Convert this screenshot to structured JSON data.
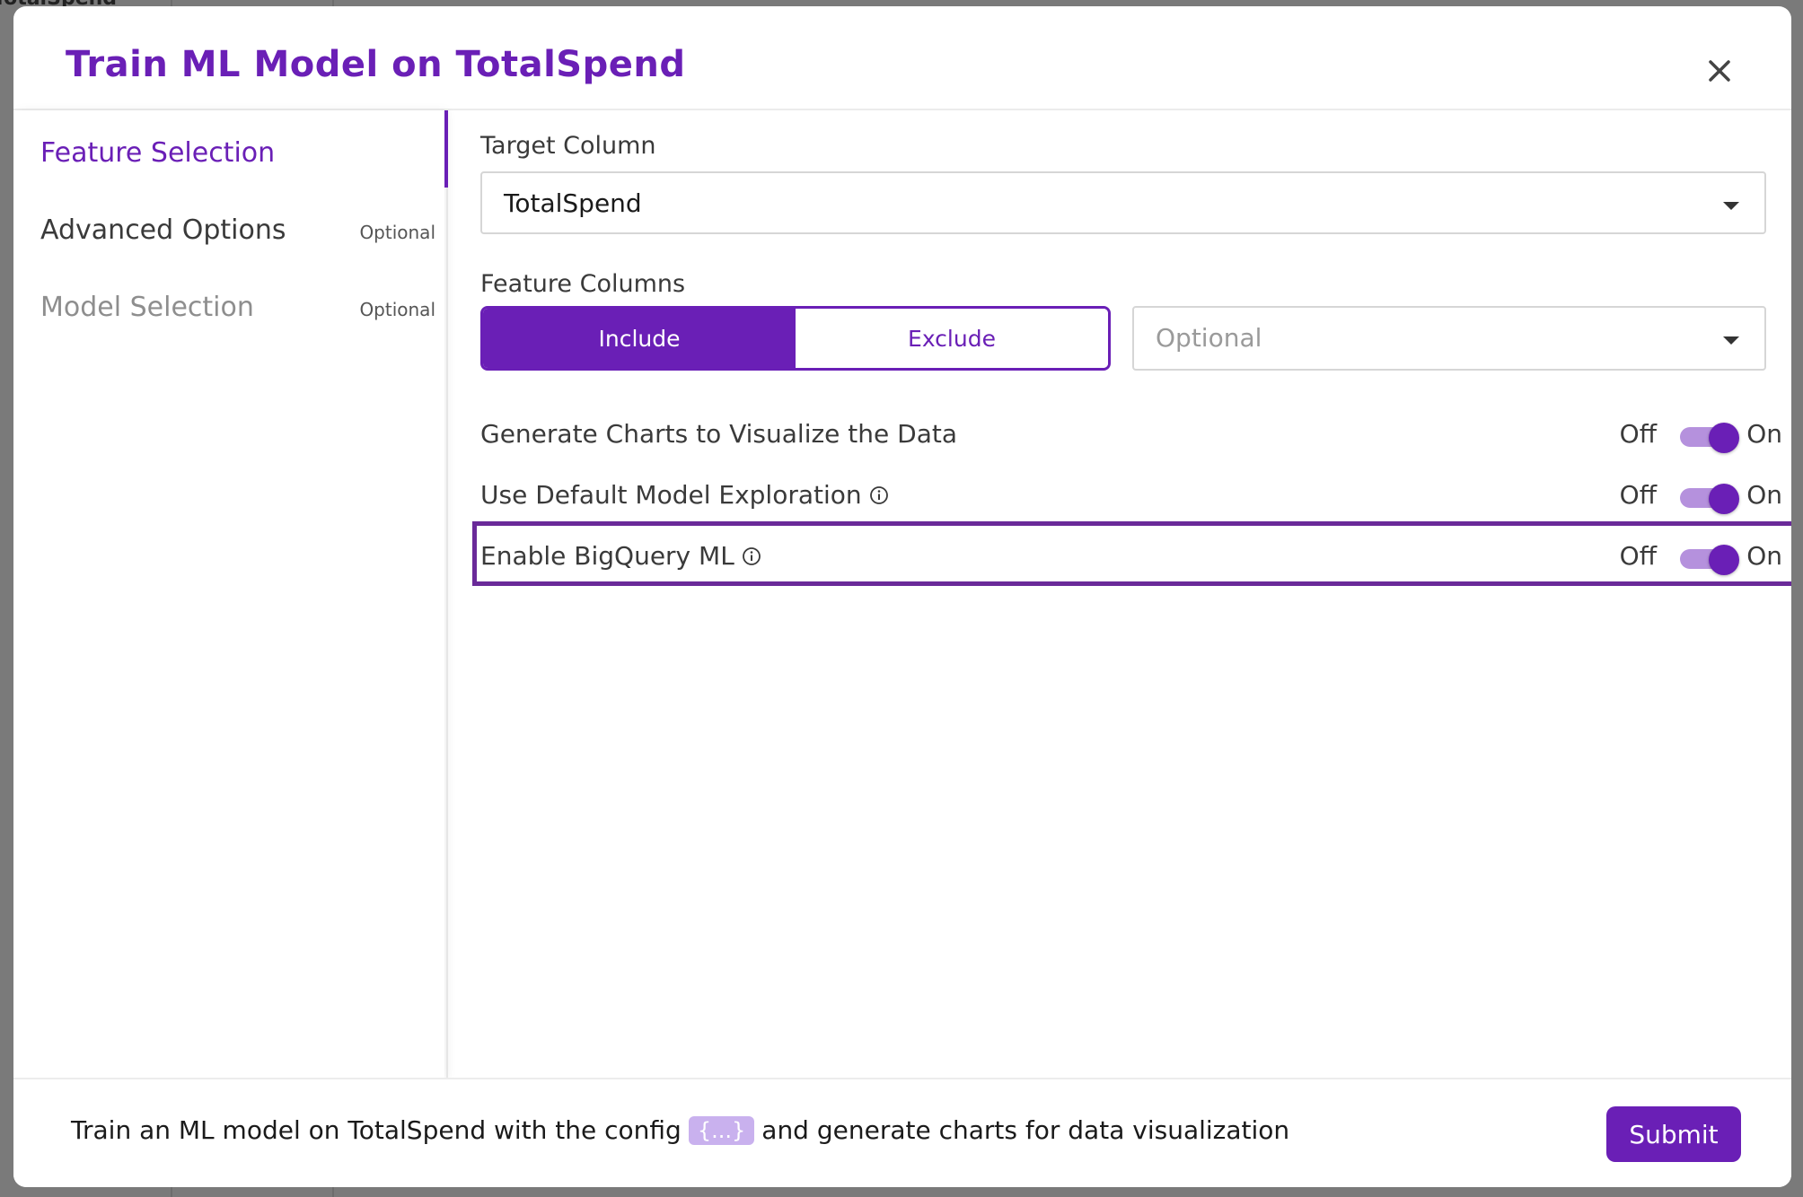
{
  "background": {
    "label": "TotalSpend"
  },
  "modal": {
    "title": "Train ML Model on TotalSpend",
    "close_icon": "close-icon"
  },
  "sidebar": {
    "steps": [
      {
        "label": "Feature Selection",
        "tag": "",
        "state": "active"
      },
      {
        "label": "Advanced Options",
        "tag": "Optional",
        "state": "enabled"
      },
      {
        "label": "Model Selection",
        "tag": "Optional",
        "state": "disabled"
      }
    ]
  },
  "form": {
    "target_column": {
      "label": "Target Column",
      "value": "TotalSpend"
    },
    "feature_columns": {
      "label": "Feature Columns",
      "include_label": "Include",
      "exclude_label": "Exclude",
      "selected": "Include",
      "select_placeholder": "Optional"
    },
    "toggles": [
      {
        "label": "Generate Charts to Visualize the Data",
        "off_label": "Off",
        "on_label": "On",
        "value": "On",
        "info": false
      },
      {
        "label": "Use Default Model Exploration",
        "off_label": "Off",
        "on_label": "On",
        "value": "On",
        "info": true
      },
      {
        "label": "Enable BigQuery ML",
        "off_label": "Off",
        "on_label": "On",
        "value": "On",
        "info": true
      }
    ]
  },
  "footer": {
    "summary_before": "Train an ML model on TotalSpend with the config",
    "config_chip": "{...}",
    "summary_after": "and generate charts for data visualization",
    "submit_label": "Submit"
  },
  "colors": {
    "accent": "#6a1fb6",
    "accent_light": "#b591dd",
    "highlight_border": "#6a2a99"
  }
}
